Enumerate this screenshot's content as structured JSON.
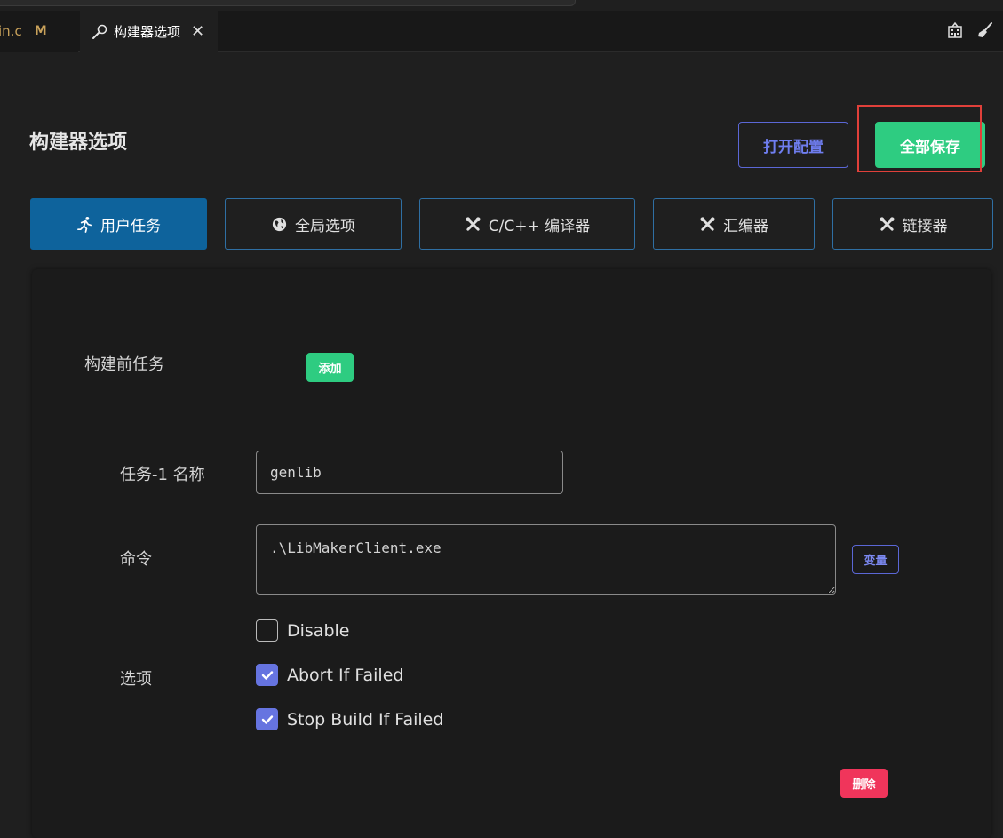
{
  "tabs": {
    "previous": {
      "filename": "in.c",
      "status": "M"
    },
    "active": {
      "label": "构建器选项"
    }
  },
  "header": {
    "title": "构建器选项",
    "open_config_label": "打开配置",
    "save_all_label": "全部保存"
  },
  "categories": [
    {
      "label": "用户任务",
      "icon": "running-person-icon",
      "active": true
    },
    {
      "label": "全局选项",
      "icon": "globe-icon",
      "active": false
    },
    {
      "label": "C/C++ 编译器",
      "icon": "tools-icon",
      "active": false
    },
    {
      "label": "汇编器",
      "icon": "tools-icon",
      "active": false
    },
    {
      "label": "链接器",
      "icon": "tools-icon",
      "active": false
    }
  ],
  "prebuild": {
    "section_label": "构建前任务",
    "add_label": "添加",
    "task": {
      "name_label": "任务-1 名称",
      "name_value": "genlib",
      "command_label": "命令",
      "command_value": ".\\LibMakerClient.exe",
      "variable_label": "变量",
      "options_label": "选项",
      "options": [
        {
          "label": "Disable",
          "checked": false
        },
        {
          "label": "Abort If Failed",
          "checked": true
        },
        {
          "label": "Stop Build If Failed",
          "checked": true
        }
      ],
      "delete_label": "删除"
    }
  },
  "colors": {
    "accent_blue": "#0e639c",
    "save_green": "#2ecc81",
    "outline_indigo": "#5b67d6",
    "delete_red": "#f0355b",
    "highlight_red": "#e0403a"
  }
}
